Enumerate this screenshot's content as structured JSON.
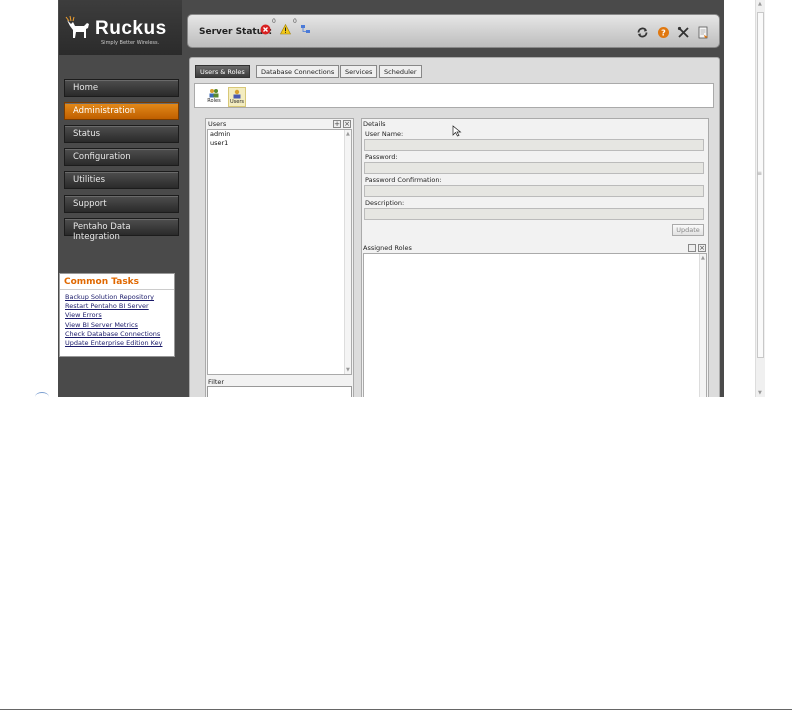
{
  "header": {
    "logo_text": "Ruckus",
    "logo_tagline": "Simply Better Wireless.",
    "server_status_label": "Server Status:",
    "error_count": "0",
    "warning_count": "0",
    "icons": [
      "error-icon",
      "warning-icon",
      "network-icon",
      "refresh-icon",
      "help-icon",
      "tools-icon",
      "logout-icon"
    ]
  },
  "nav": {
    "items": [
      {
        "label": "Home",
        "active": false
      },
      {
        "label": "Administration",
        "active": true
      },
      {
        "label": "Status",
        "active": false
      },
      {
        "label": "Configuration",
        "active": false
      },
      {
        "label": "Utilities",
        "active": false
      },
      {
        "label": "Support",
        "active": false
      },
      {
        "label": "Pentaho Data Integration",
        "active": false
      }
    ]
  },
  "common_tasks": {
    "title": "Common Tasks",
    "links": [
      "Backup Solution Repository",
      "Restart Pentaho BI Server",
      "View Errors",
      "View BI Server Metrics",
      "Check Database Connections",
      "Update Enterprise Edition Key"
    ]
  },
  "tabs": [
    "Users & Roles",
    "Database Connections",
    "Services",
    "Scheduler"
  ],
  "toolbar": {
    "roles_label": "Roles",
    "users_label": "Users"
  },
  "users_panel": {
    "title": "Users",
    "users": [
      "admin",
      "user1"
    ],
    "filter_label": "Filter",
    "filter_value": ""
  },
  "details_panel": {
    "title": "Details",
    "user_name_label": "User Name:",
    "user_name_value": "",
    "password_label": "Password:",
    "password_confirmation_label": "Password Confirmation:",
    "description_label": "Description:",
    "update_label": "Update",
    "assigned_roles_label": "Assigned Roles"
  },
  "colors": {
    "accent_orange": "#d87300",
    "nav_dark": "#333333",
    "link_blue": "#1a1a6a"
  }
}
